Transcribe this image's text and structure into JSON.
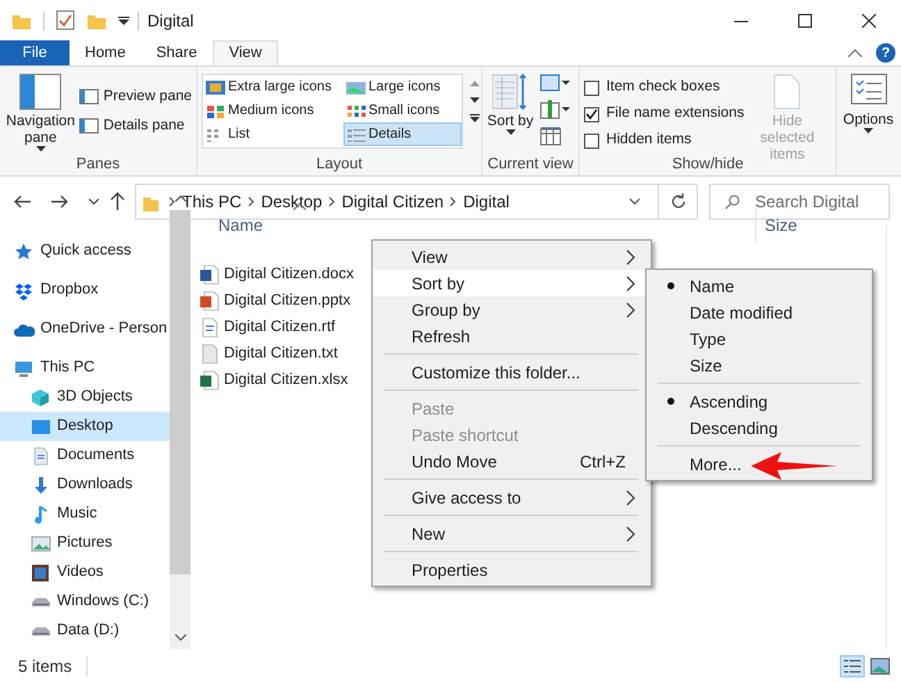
{
  "window": {
    "title": "Digital"
  },
  "ribbon_tabs": [
    {
      "label": "File",
      "kind": "file",
      "selected": false
    },
    {
      "label": "Home",
      "kind": "tab",
      "selected": false
    },
    {
      "label": "Share",
      "kind": "tab",
      "selected": false
    },
    {
      "label": "View",
      "kind": "tab",
      "selected": true
    }
  ],
  "help": "?",
  "panes": {
    "label": "Panes",
    "big": "Navigation pane",
    "small": [
      "Preview pane",
      "Details pane"
    ]
  },
  "layout": {
    "label": "Layout",
    "items": [
      {
        "label": "Extra large icons",
        "selected": false
      },
      {
        "label": "Large icons",
        "selected": false
      },
      {
        "label": "Medium icons",
        "selected": false
      },
      {
        "label": "Small icons",
        "selected": false
      },
      {
        "label": "List",
        "selected": false
      },
      {
        "label": "Details",
        "selected": true
      }
    ]
  },
  "current_view": {
    "label": "Current view",
    "sort": "Sort by"
  },
  "show_hide": {
    "label": "Show/hide",
    "checkboxes": [
      {
        "label": "Item check boxes",
        "checked": false
      },
      {
        "label": "File name extensions",
        "checked": true
      },
      {
        "label": "Hidden items",
        "checked": false
      }
    ],
    "hide_selected": {
      "label": "Hide selected items",
      "disabled": true
    }
  },
  "options": {
    "label": "Options"
  },
  "address": {
    "path": [
      "This PC",
      "Desktop",
      "Digital Citizen",
      "Digital"
    ],
    "search_placeholder": "Search Digital"
  },
  "columns": [
    "Name",
    "Size"
  ],
  "navigation": [
    {
      "label": "Quick access",
      "kind": "star",
      "selected": false
    },
    {
      "label": "Dropbox",
      "kind": "dropbox",
      "selected": false
    },
    {
      "label": "OneDrive - Person",
      "kind": "cloud",
      "selected": false
    },
    {
      "label": "This PC",
      "kind": "pc",
      "selected": false,
      "children": [
        {
          "label": "3D Objects",
          "kind": "cube",
          "selected": false
        },
        {
          "label": "Desktop",
          "kind": "desktop",
          "selected": true
        },
        {
          "label": "Documents",
          "kind": "doc",
          "selected": false
        },
        {
          "label": "Downloads",
          "kind": "down",
          "selected": false
        },
        {
          "label": "Music",
          "kind": "music",
          "selected": false
        },
        {
          "label": "Pictures",
          "kind": "pictures",
          "selected": false
        },
        {
          "label": "Videos",
          "kind": "videos",
          "selected": false
        },
        {
          "label": "Windows (C:)",
          "kind": "drive",
          "selected": false
        },
        {
          "label": "Data (D:)",
          "kind": "drive",
          "selected": false
        }
      ]
    }
  ],
  "files": [
    {
      "name": "Digital Citizen.docx",
      "kind": "word"
    },
    {
      "name": "Digital Citizen.pptx",
      "kind": "powerpoint"
    },
    {
      "name": "Digital Citizen.rtf",
      "kind": "rtf"
    },
    {
      "name": "Digital Citizen.txt",
      "kind": "text"
    },
    {
      "name": "Digital Citizen.xlsx",
      "kind": "excel"
    }
  ],
  "context_menu": [
    {
      "kind": "item",
      "label": "View",
      "submenu": true,
      "selected": false,
      "disabled": false
    },
    {
      "kind": "item",
      "label": "Sort by",
      "submenu": true,
      "selected": true,
      "disabled": false
    },
    {
      "kind": "item",
      "label": "Group by",
      "submenu": true,
      "selected": false,
      "disabled": false
    },
    {
      "kind": "item",
      "label": "Refresh",
      "submenu": false,
      "selected": false,
      "disabled": false
    },
    {
      "kind": "separator"
    },
    {
      "kind": "item",
      "label": "Customize this folder...",
      "submenu": false,
      "selected": false,
      "disabled": false
    },
    {
      "kind": "separator"
    },
    {
      "kind": "item",
      "label": "Paste",
      "submenu": false,
      "selected": false,
      "disabled": true
    },
    {
      "kind": "item",
      "label": "Paste shortcut",
      "submenu": false,
      "selected": false,
      "disabled": true
    },
    {
      "kind": "item",
      "label": "Undo Move",
      "shortcut": "Ctrl+Z",
      "submenu": false,
      "selected": false,
      "disabled": false
    },
    {
      "kind": "separator"
    },
    {
      "kind": "item",
      "label": "Give access to",
      "submenu": true,
      "selected": false,
      "disabled": false
    },
    {
      "kind": "separator"
    },
    {
      "kind": "item",
      "label": "New",
      "submenu": true,
      "selected": false,
      "disabled": false
    },
    {
      "kind": "separator"
    },
    {
      "kind": "item",
      "label": "Properties",
      "submenu": false,
      "selected": false,
      "disabled": false
    }
  ],
  "sort_menu": [
    {
      "kind": "item",
      "label": "Name",
      "checked": true
    },
    {
      "kind": "item",
      "label": "Date modified",
      "checked": false
    },
    {
      "kind": "item",
      "label": "Type",
      "checked": false
    },
    {
      "kind": "item",
      "label": "Size",
      "checked": false
    },
    {
      "kind": "separator"
    },
    {
      "kind": "item",
      "label": "Ascending",
      "checked": true
    },
    {
      "kind": "item",
      "label": "Descending",
      "checked": false
    },
    {
      "kind": "separator"
    },
    {
      "kind": "item",
      "label": "More...",
      "checked": false
    }
  ],
  "status_bar": {
    "text": "5 items"
  }
}
